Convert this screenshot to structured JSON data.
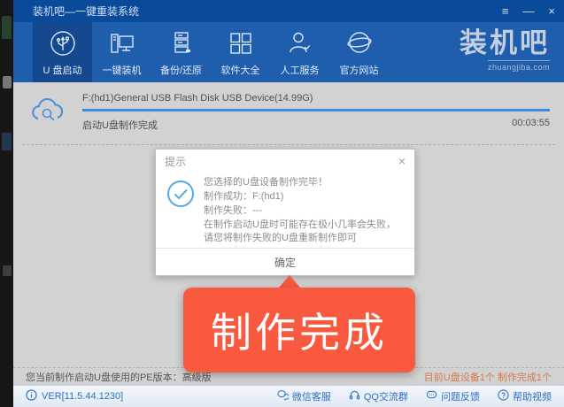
{
  "window": {
    "title": "装机吧—一键重装系统",
    "controls": {
      "menu": "≡",
      "minimize": "—",
      "close": "×"
    }
  },
  "nav": {
    "items": [
      {
        "label": "U 盘启动",
        "active": true
      },
      {
        "label": "一键装机",
        "active": false
      },
      {
        "label": "备份/还原",
        "active": false
      },
      {
        "label": "软件大全",
        "active": false
      },
      {
        "label": "人工服务",
        "active": false
      },
      {
        "label": "官方网站",
        "active": false
      }
    ],
    "logo": {
      "text": "装机吧",
      "domain": "zhuangjiba.com"
    }
  },
  "task": {
    "device": "F:(hd1)General USB Flash Disk USB Device(14.99G)",
    "status": "启动U盘制作完成",
    "elapsed": "00:03:55",
    "progress_percent": 100
  },
  "dialog": {
    "title": "提示",
    "close": "×",
    "lines": [
      "您选择的U盘设备制作完毕！",
      "制作成功：F:(hd1)",
      "制作失败：---",
      "在制作启动U盘时可能存在极小几率会失败，请您将制作失败的U盘重新制作即可"
    ],
    "ok_label": "确定"
  },
  "callout": {
    "text": "制作完成",
    "color": "#f9593f"
  },
  "status_bar": {
    "left": "您当前制作启动U盘使用的PE版本：高级版",
    "right": "目前U盘设备1个 制作完成1个"
  },
  "footer": {
    "version": "VER[11.5.44.1230]",
    "links": [
      {
        "label": "微信客服"
      },
      {
        "label": "QQ交流群"
      },
      {
        "label": "问题反馈"
      },
      {
        "label": "帮助视频"
      }
    ]
  },
  "colors": {
    "titlebar": "#0a4a9b",
    "nav": "#1f5dad",
    "nav_active": "#15498f",
    "progress": "#3c8ddb",
    "callout": "#f9593f",
    "status_highlight": "#d57a4c",
    "link_blue": "#2e6fc0"
  }
}
